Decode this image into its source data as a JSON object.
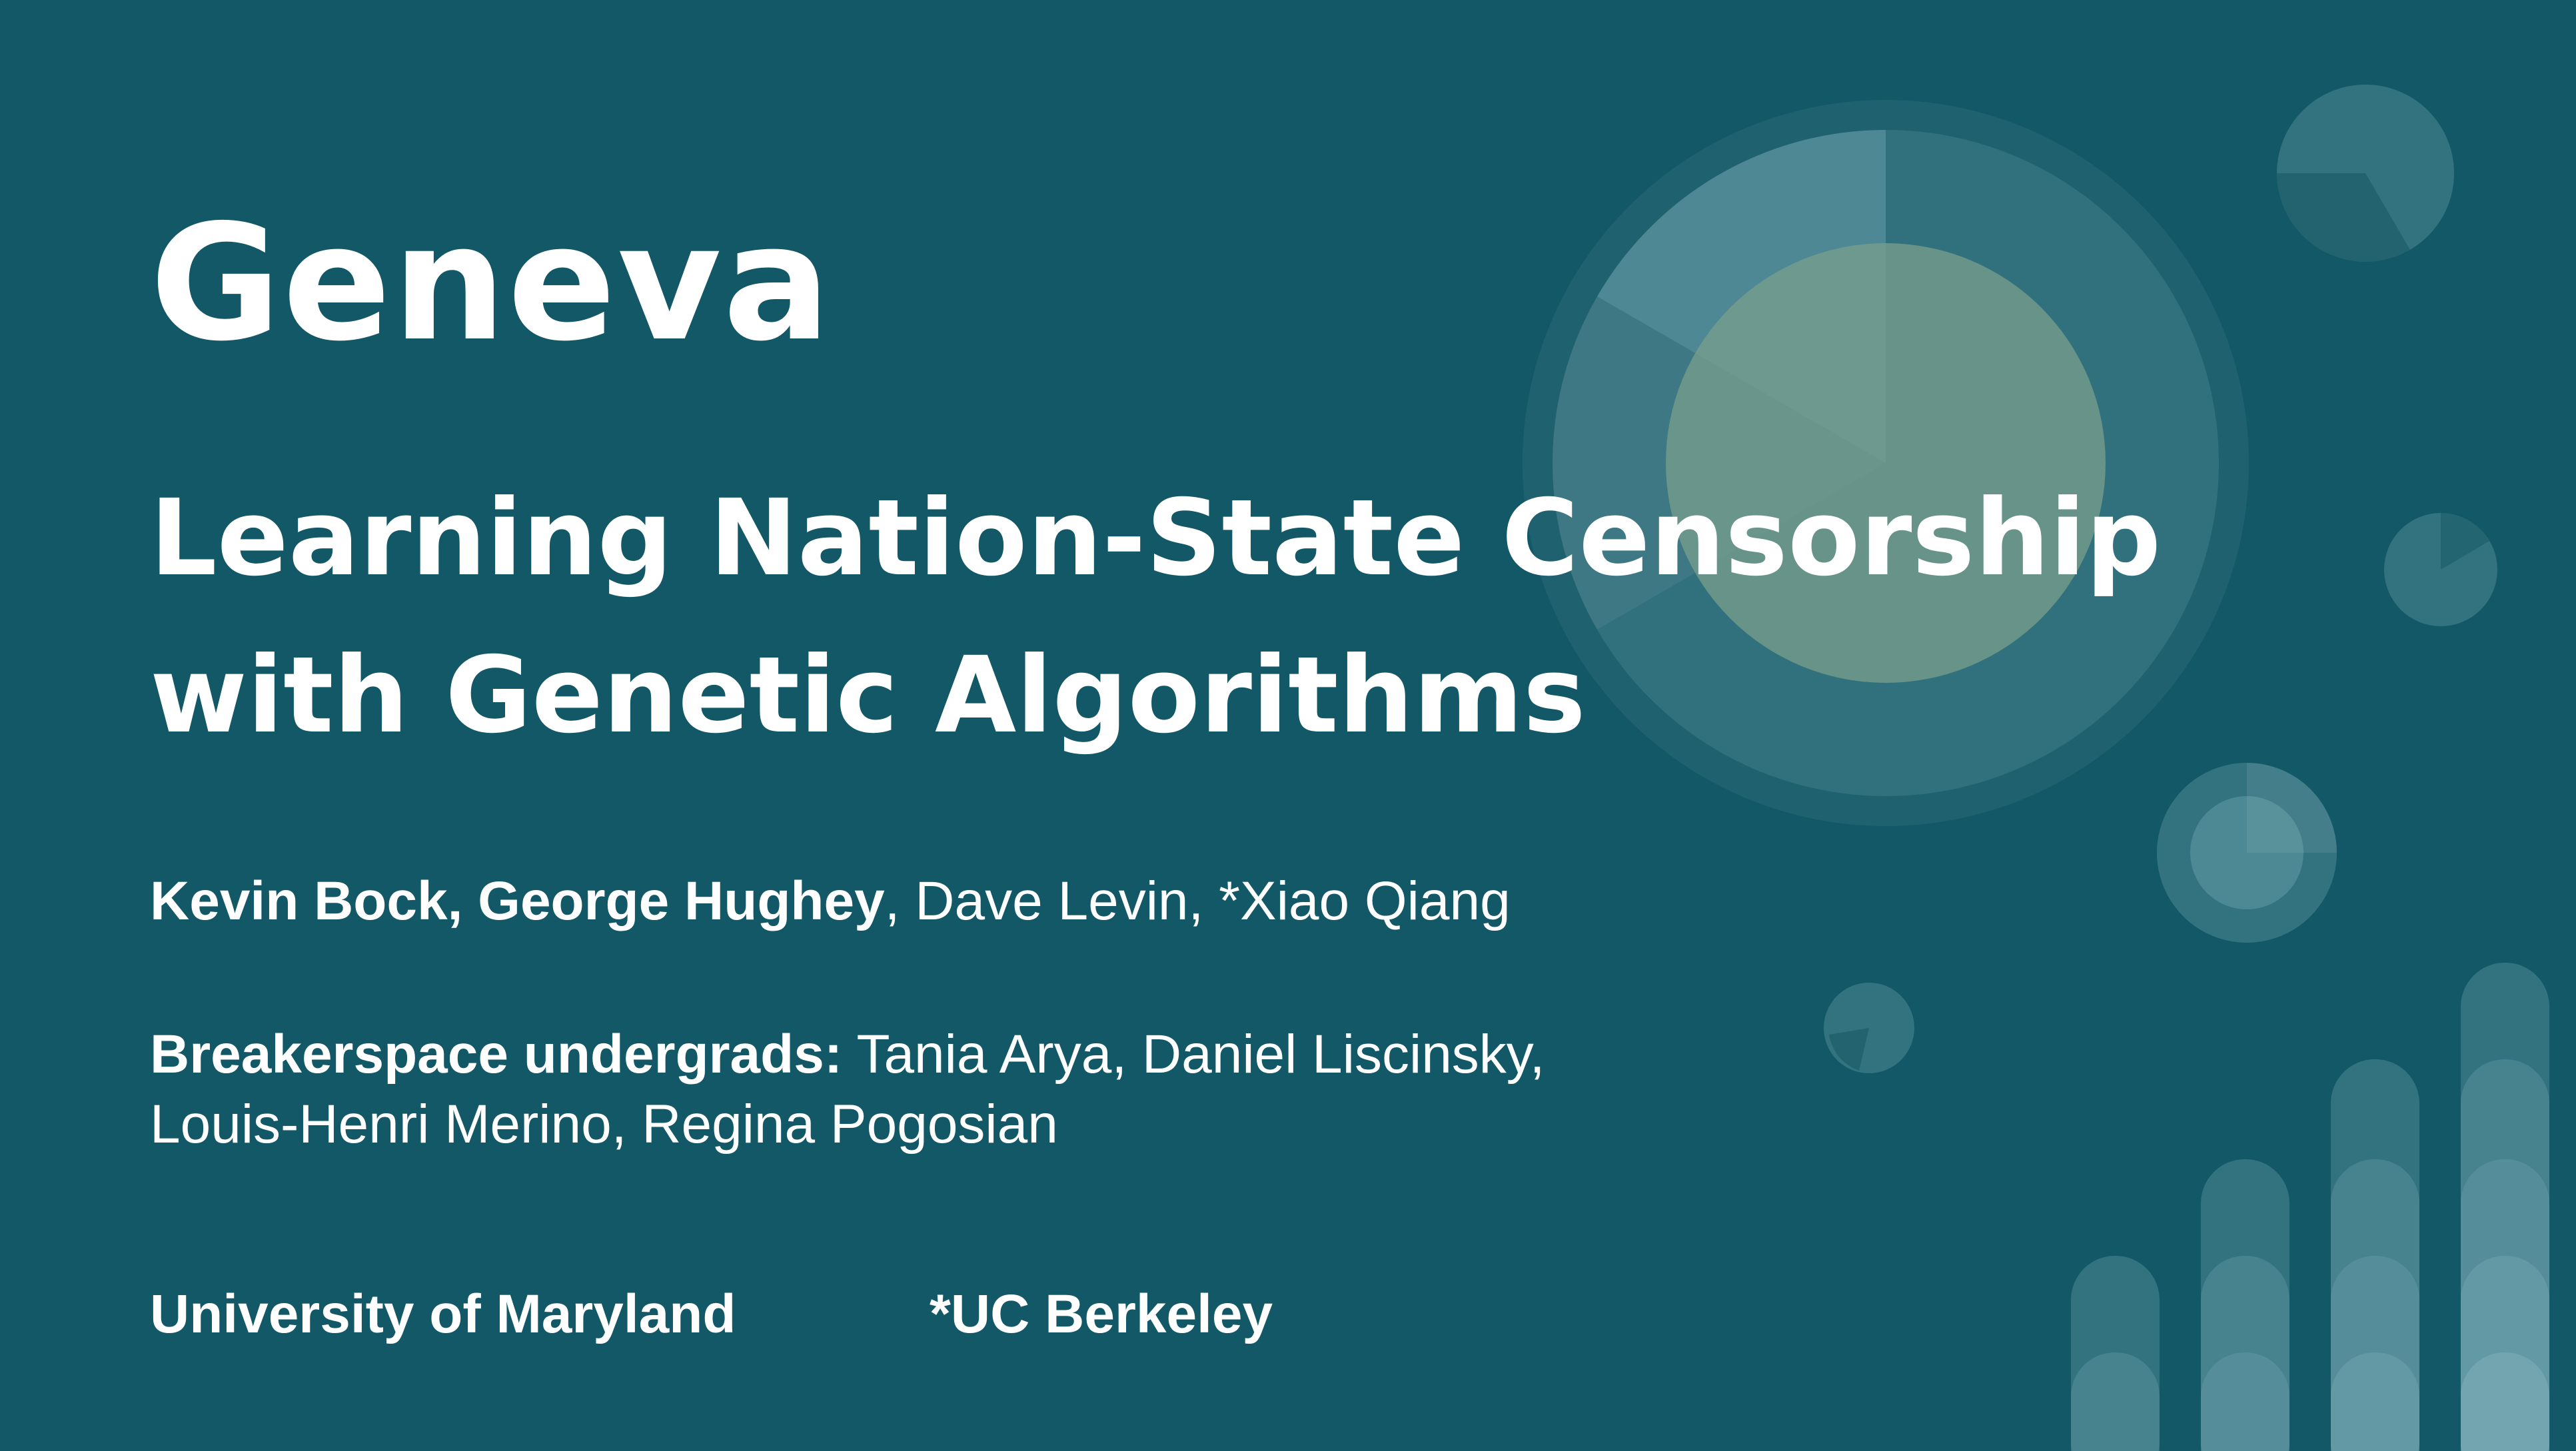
{
  "title": "Geneva",
  "subtitle": {
    "line1": "Learning Nation-State Censorship",
    "line2": "with Genetic Algorithms"
  },
  "authors": {
    "primary": "Kevin Bock, George Hughey",
    "others": ", Dave Levin, *Xiao Qiang"
  },
  "undergrads": {
    "label": "Breakerspace undergrads:",
    "names_line1": " Tania Arya, Daniel Liscinsky,",
    "names_line2": "Louis-Henri Merino, Regina Pogosian"
  },
  "affiliations": {
    "primary": "University of Maryland",
    "secondary": "*UC Berkeley"
  },
  "colors": {
    "background": "#135866",
    "text": "#ffffff",
    "decoration_light": "#7fb3bb",
    "decoration_sage": "#7a9f8c"
  }
}
